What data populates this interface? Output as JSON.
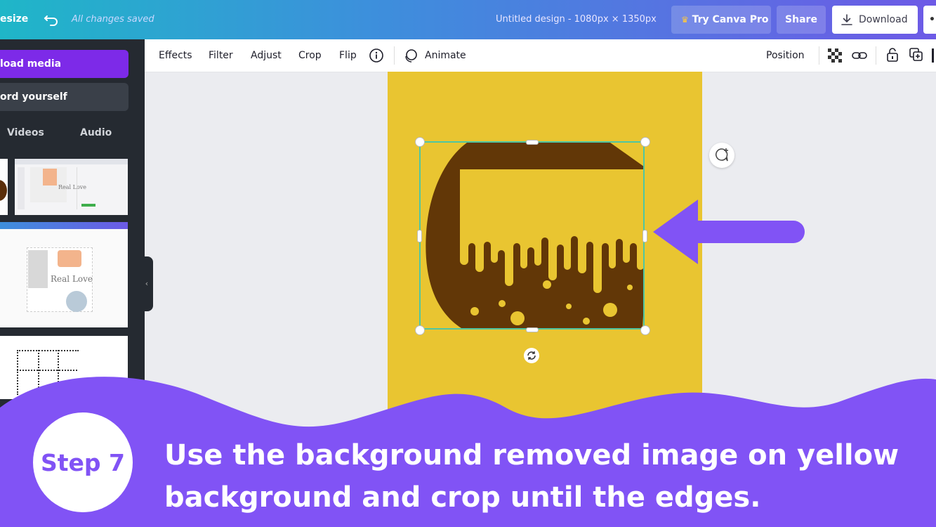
{
  "topbar": {
    "resize_label": "esize",
    "saved_status": "All changes saved",
    "design_title": "Untitled design - 1080px × 1350px",
    "try_pro_label": "Try Canva Pro",
    "share_label": "Share",
    "download_label": "Download",
    "more_label": "•"
  },
  "sidebar": {
    "upload_label": "load media",
    "record_label": "ord yourself",
    "tabs": [
      "Videos",
      "Audio"
    ],
    "thumb_texts": [
      "Real Love",
      "Real Love"
    ]
  },
  "toolbar": {
    "effects": "Effects",
    "filter": "Filter",
    "adjust": "Adjust",
    "crop": "Crop",
    "flip": "Flip",
    "animate": "Animate",
    "position": "Position"
  },
  "colors": {
    "accent_purple": "#8153f5",
    "canvas_yellow": "#e9c531",
    "drip_brown": "#623707",
    "selection_teal": "#4fc6a3"
  },
  "footer": {
    "step_label": "Step 7",
    "caption": "Use the background removed image on yellow background and crop until the edges."
  }
}
